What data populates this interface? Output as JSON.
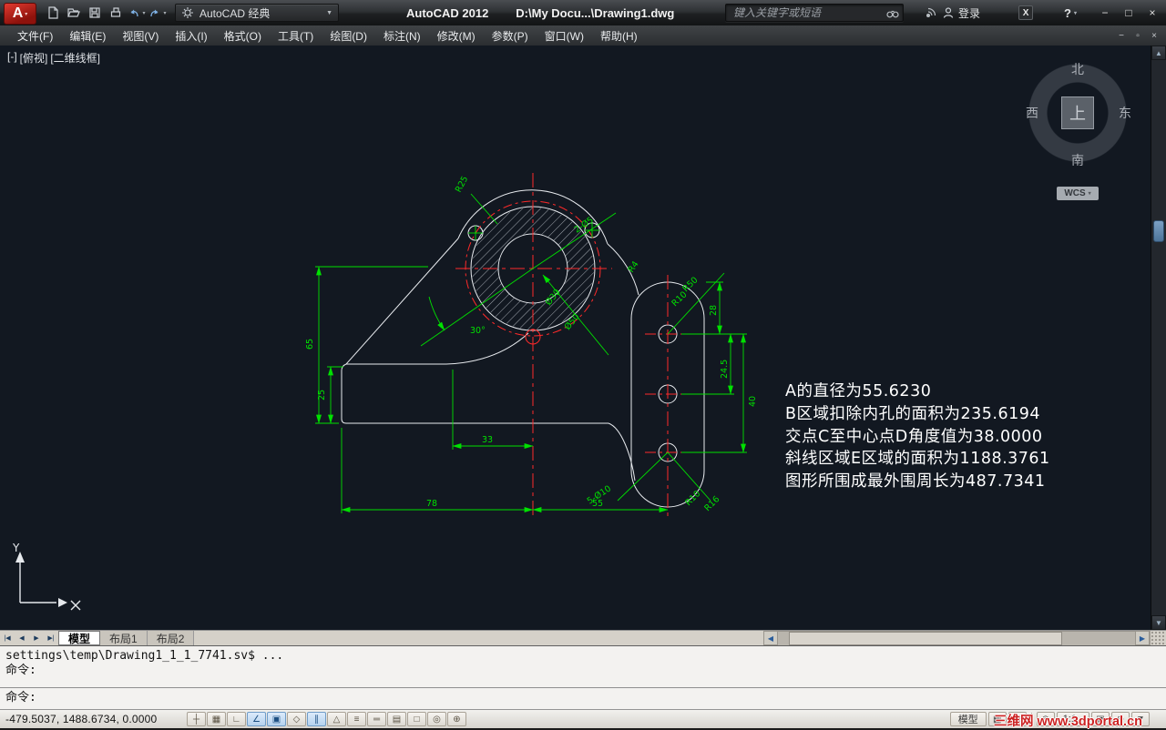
{
  "titlebar": {
    "logo_letter": "A",
    "workspace": "AutoCAD 经典",
    "app_title": "AutoCAD 2012",
    "doc_path": "D:\\My Docu...\\Drawing1.dwg",
    "search_placeholder": "键入关键字或短语",
    "login": "登录"
  },
  "menubar": {
    "items": [
      "文件(F)",
      "编辑(E)",
      "视图(V)",
      "插入(I)",
      "格式(O)",
      "工具(T)",
      "绘图(D)",
      "标注(N)",
      "修改(M)",
      "参数(P)",
      "窗口(W)",
      "帮助(H)"
    ]
  },
  "viewport": {
    "vp_minus": "[-]",
    "vp_view": "[俯视]",
    "vp_style": "[二维线框]",
    "compass": {
      "n": "北",
      "s": "南",
      "e": "东",
      "w": "西",
      "center": "上"
    },
    "wcs": "WCS",
    "ucs_y": "Y",
    "annotations": [
      "A的直径为55.6230",
      "B区域扣除内孔的面积为235.6194",
      "交点C至中心点D角度值为38.0000",
      "斜线区域E区域的面积为1188.3761",
      "图形所围成最外围周长为487.7341"
    ]
  },
  "dims": {
    "v65": "65",
    "v25": "25",
    "h33": "33",
    "h78": "78",
    "h55": "55",
    "v245": "24.5",
    "v40": "40",
    "v28": "28",
    "a30": "30°",
    "r25": "R25",
    "n2d5": "2-Ø5",
    "d30": "Ø30",
    "d50": "Ø50",
    "r50": "R50",
    "r10": "R10",
    "r4": "R4",
    "n5d10": "5-Ø10",
    "r10b": "R10",
    "r16": "R16"
  },
  "tabs": {
    "model": "模型",
    "layout1": "布局1",
    "layout2": "布局2"
  },
  "command": {
    "history_line": "settings\\temp\\Drawing1_1_1_7741.sv$ ...",
    "prompt_prev": "命令:",
    "prompt_current": "命令:"
  },
  "statusbar": {
    "coords": "-479.5037, 1488.6734, 0.0000",
    "model_label": "模型",
    "scale": "1:1",
    "watermark": "三维网 www.3dportal.cn",
    "toggles": [
      {
        "name": "snap",
        "glyph": "┼",
        "active": false
      },
      {
        "name": "grid",
        "glyph": "▦",
        "active": false
      },
      {
        "name": "ortho",
        "glyph": "∟",
        "active": false
      },
      {
        "name": "polar",
        "glyph": "∠",
        "active": true
      },
      {
        "name": "osnap",
        "glyph": "▣",
        "active": true
      },
      {
        "name": "osnap-3d",
        "glyph": "◇",
        "active": false
      },
      {
        "name": "otrack",
        "glyph": "∥",
        "active": true
      },
      {
        "name": "ducs",
        "glyph": "△",
        "active": false
      },
      {
        "name": "dyn",
        "glyph": "≡",
        "active": false
      },
      {
        "name": "lineweight",
        "glyph": "═",
        "active": false
      },
      {
        "name": "transparency",
        "glyph": "▤",
        "active": false
      },
      {
        "name": "quick-properties",
        "glyph": "□",
        "active": false
      },
      {
        "name": "selection-cycling",
        "glyph": "◎",
        "active": false
      },
      {
        "name": "annotation-monitor",
        "glyph": "⊕",
        "active": false
      }
    ]
  },
  "icons": {
    "caret_down": "▼",
    "caret_small": "▾",
    "minimize": "−",
    "maximize": "□",
    "close": "×",
    "doc_minimize": "−",
    "doc_restore": "▫",
    "doc_close": "×",
    "question": "?",
    "x_letter": "X",
    "up": "▲",
    "down": "▼",
    "left": "◀",
    "right": "▶",
    "tab_first": "|◀",
    "tab_prev": "◀",
    "tab_next": "▶",
    "tab_last": "▶|",
    "grid": "▦",
    "sheet": "▤",
    "box": "▣",
    "target": "◎",
    "plus": "⊕"
  }
}
